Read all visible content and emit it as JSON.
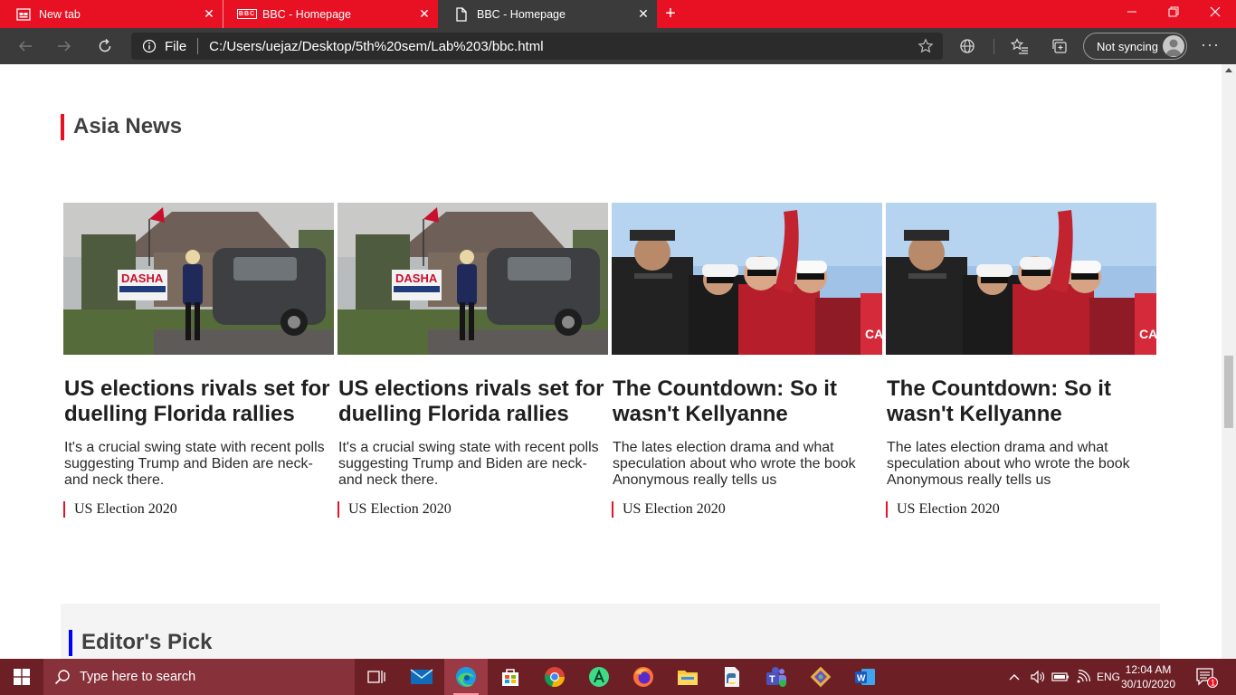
{
  "browser": {
    "tabs": [
      {
        "title": "New tab"
      },
      {
        "title": "BBC - Homepage",
        "favicon": "BBC"
      },
      {
        "title": "BBC - Homepage"
      }
    ],
    "address": {
      "scheme": "File",
      "url": "C:/Users/uejaz/Desktop/5th%20sem/Lab%203/bbc.html"
    },
    "profile_label": "Not syncing",
    "colors": {
      "accent": "#e81123",
      "toolbar": "#3b3b3b"
    }
  },
  "page": {
    "section_title": "Asia News",
    "cards": [
      {
        "image": "candidate-with-car-photo",
        "headline": "US elections rivals set for duelling Florida rallies",
        "summary": "It's a crucial swing state with recent polls suggesting Trump and Biden are neck-and neck there.",
        "tag": "US Election 2020"
      },
      {
        "image": "candidate-with-car-photo",
        "headline": "US elections rivals set for duelling Florida rallies",
        "summary": "It's a crucial swing state with recent polls suggesting Trump and Biden are neck-and neck there.",
        "tag": "US Election 2020"
      },
      {
        "image": "rally-crowd-photo",
        "headline": "The Countdown: So it wasn't Kellyanne",
        "summary": "The lates election drama and what speculation about who wrote the book Anonymous really tells us",
        "tag": "US Election 2020"
      },
      {
        "image": "rally-crowd-photo",
        "headline": "The Countdown: So it wasn't Kellyanne",
        "summary": "The lates election drama and what speculation about who wrote the book Anonymous really tells us",
        "tag": "US Election 2020"
      }
    ],
    "editors_pick_title": "Editor's Pick"
  },
  "taskbar": {
    "search_placeholder": "Type here to search",
    "language": "ENG",
    "time": "12:04 AM",
    "date": "30/10/2020",
    "notification_count": "1"
  }
}
